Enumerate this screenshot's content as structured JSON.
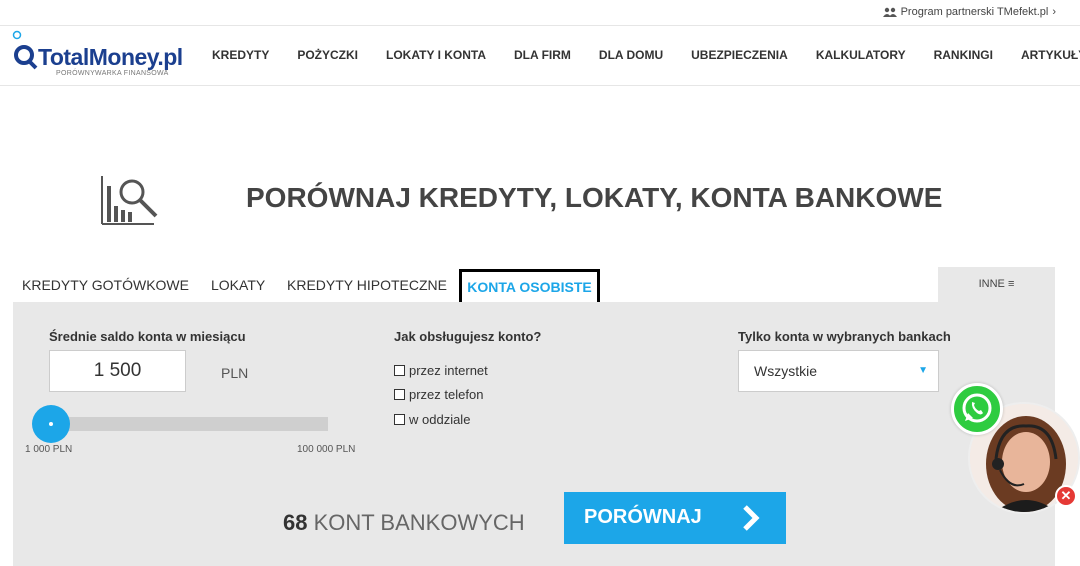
{
  "topbar": {
    "partner_label": "Program partnerski TMefekt.pl",
    "partner_arrow": "›"
  },
  "logo": {
    "name": "TotalMoney.pl",
    "tagline": "PORÓWNYWARKA FINANSOWA"
  },
  "nav": [
    "KREDYTY",
    "POŻYCZKI",
    "LOKATY I KONTA",
    "DLA FIRM",
    "DLA DOMU",
    "UBEZPIECZENIA",
    "KALKULATORY",
    "RANKINGI",
    "ARTYKUŁY"
  ],
  "hero": {
    "title": "PORÓWNAJ KREDYTY, LOKATY, KONTA BANKOWE",
    "icon": "chart-search-icon"
  },
  "tabs": {
    "items": [
      "KREDYTY GOTÓWKOWE",
      "LOKATY",
      "KREDYTY HIPOTECZNE"
    ],
    "active": "KONTA OSOBISTE",
    "more": "INNE ≡"
  },
  "form": {
    "saldo_label": "Średnie saldo konta w miesiącu",
    "saldo_value": "1 500",
    "saldo_unit": "PLN",
    "range_min": "1 000 PLN",
    "range_max": "100 000 PLN",
    "service_label": "Jak obsługujesz konto?",
    "service_options": [
      "przez internet",
      "przez telefon",
      "w oddziale"
    ],
    "banks_label": "Tylko konta w wybranych bankach",
    "banks_selected": "Wszystkie"
  },
  "result": {
    "count": "68",
    "count_label": " KONT BANKOWYCH",
    "compare_label": "PORÓWNAJ",
    "compare_arrow": "›"
  },
  "colors": {
    "accent": "#1ca6e8",
    "brand": "#1b3f8f",
    "panel": "#e8e8e8",
    "whatsapp": "#2ecc40",
    "close": "#e53935"
  }
}
